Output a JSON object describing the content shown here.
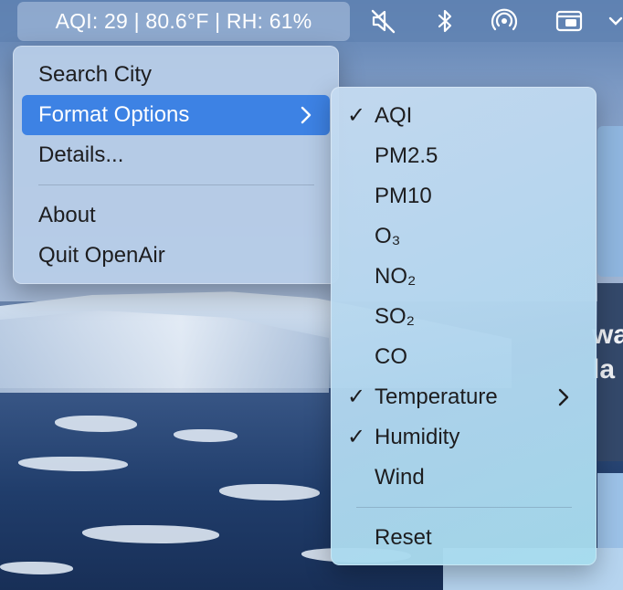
{
  "menubar": {
    "status_text": "AQI: 29 | 80.6°F | RH: 61%",
    "icons": [
      "mute-icon",
      "bluetooth-icon",
      "airdrop-icon",
      "screen-window-icon"
    ]
  },
  "main_menu": {
    "items": [
      {
        "label": "Search City"
      },
      {
        "label": "Format Options",
        "has_submenu": true,
        "highlighted": true
      },
      {
        "label": "Details..."
      },
      {
        "label": "About"
      },
      {
        "label": "Quit OpenAir"
      }
    ]
  },
  "format_submenu": {
    "items": [
      {
        "label": "AQI",
        "checked": true
      },
      {
        "label": "PM2.5",
        "checked": false
      },
      {
        "label": "PM10",
        "checked": false
      },
      {
        "label": "O₃",
        "checked": false
      },
      {
        "label": "NO₂",
        "checked": false
      },
      {
        "label": "SO₂",
        "checked": false
      },
      {
        "label": "CO",
        "checked": false
      },
      {
        "label": "Temperature",
        "checked": true,
        "has_submenu": true
      },
      {
        "label": "Humidity",
        "checked": true
      },
      {
        "label": "Wind",
        "checked": false
      },
      {
        "label": "Reset",
        "checked": false
      }
    ],
    "checkmark": "✓"
  },
  "background_window": {
    "text_fragments": [
      "wa",
      "la"
    ]
  },
  "colors": {
    "highlight": "#3d82e4",
    "menubar": "#6082b2"
  }
}
